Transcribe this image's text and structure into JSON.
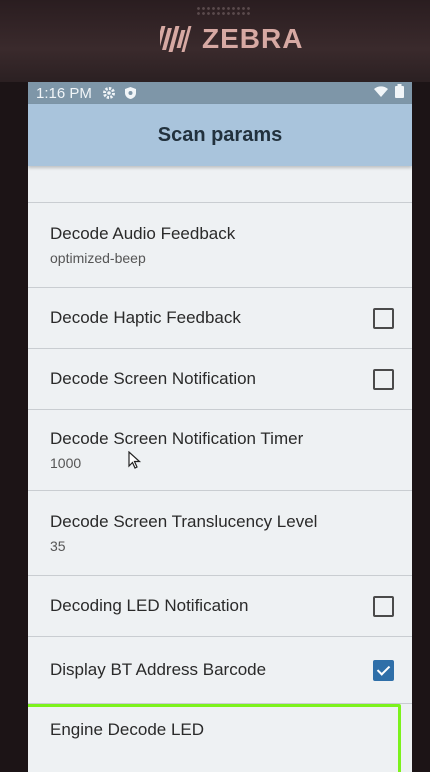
{
  "device": {
    "brand": "ZEBRA"
  },
  "status_bar": {
    "time": "1:16 PM",
    "icons": [
      "gear-icon",
      "shield-icon",
      "wifi-icon",
      "battery-icon"
    ]
  },
  "app_bar": {
    "title": "Scan params"
  },
  "settings": [
    {
      "title": "Decode Audio Feedback",
      "summary": "optimized-beep",
      "has_checkbox": false
    },
    {
      "title": "Decode Haptic Feedback",
      "summary": "",
      "has_checkbox": true,
      "checked": false
    },
    {
      "title": "Decode Screen Notification",
      "summary": "",
      "has_checkbox": true,
      "checked": false
    },
    {
      "title": "Decode Screen Notification Timer",
      "summary": "1000",
      "has_checkbox": false
    },
    {
      "title": "Decode Screen Translucency Level",
      "summary": "35",
      "has_checkbox": false
    },
    {
      "title": "Decoding LED Notification",
      "summary": "",
      "has_checkbox": true,
      "checked": false
    },
    {
      "title": "Display BT Address Barcode",
      "summary": "",
      "has_checkbox": true,
      "checked": true
    },
    {
      "title": "Engine Decode LED",
      "summary": "",
      "has_checkbox": false
    }
  ],
  "colors": {
    "app_bar": "#a9c4dc",
    "status_bar": "#7e96a8",
    "highlight": "#7cf21c",
    "checkbox_checked": "#2f6fa8"
  }
}
